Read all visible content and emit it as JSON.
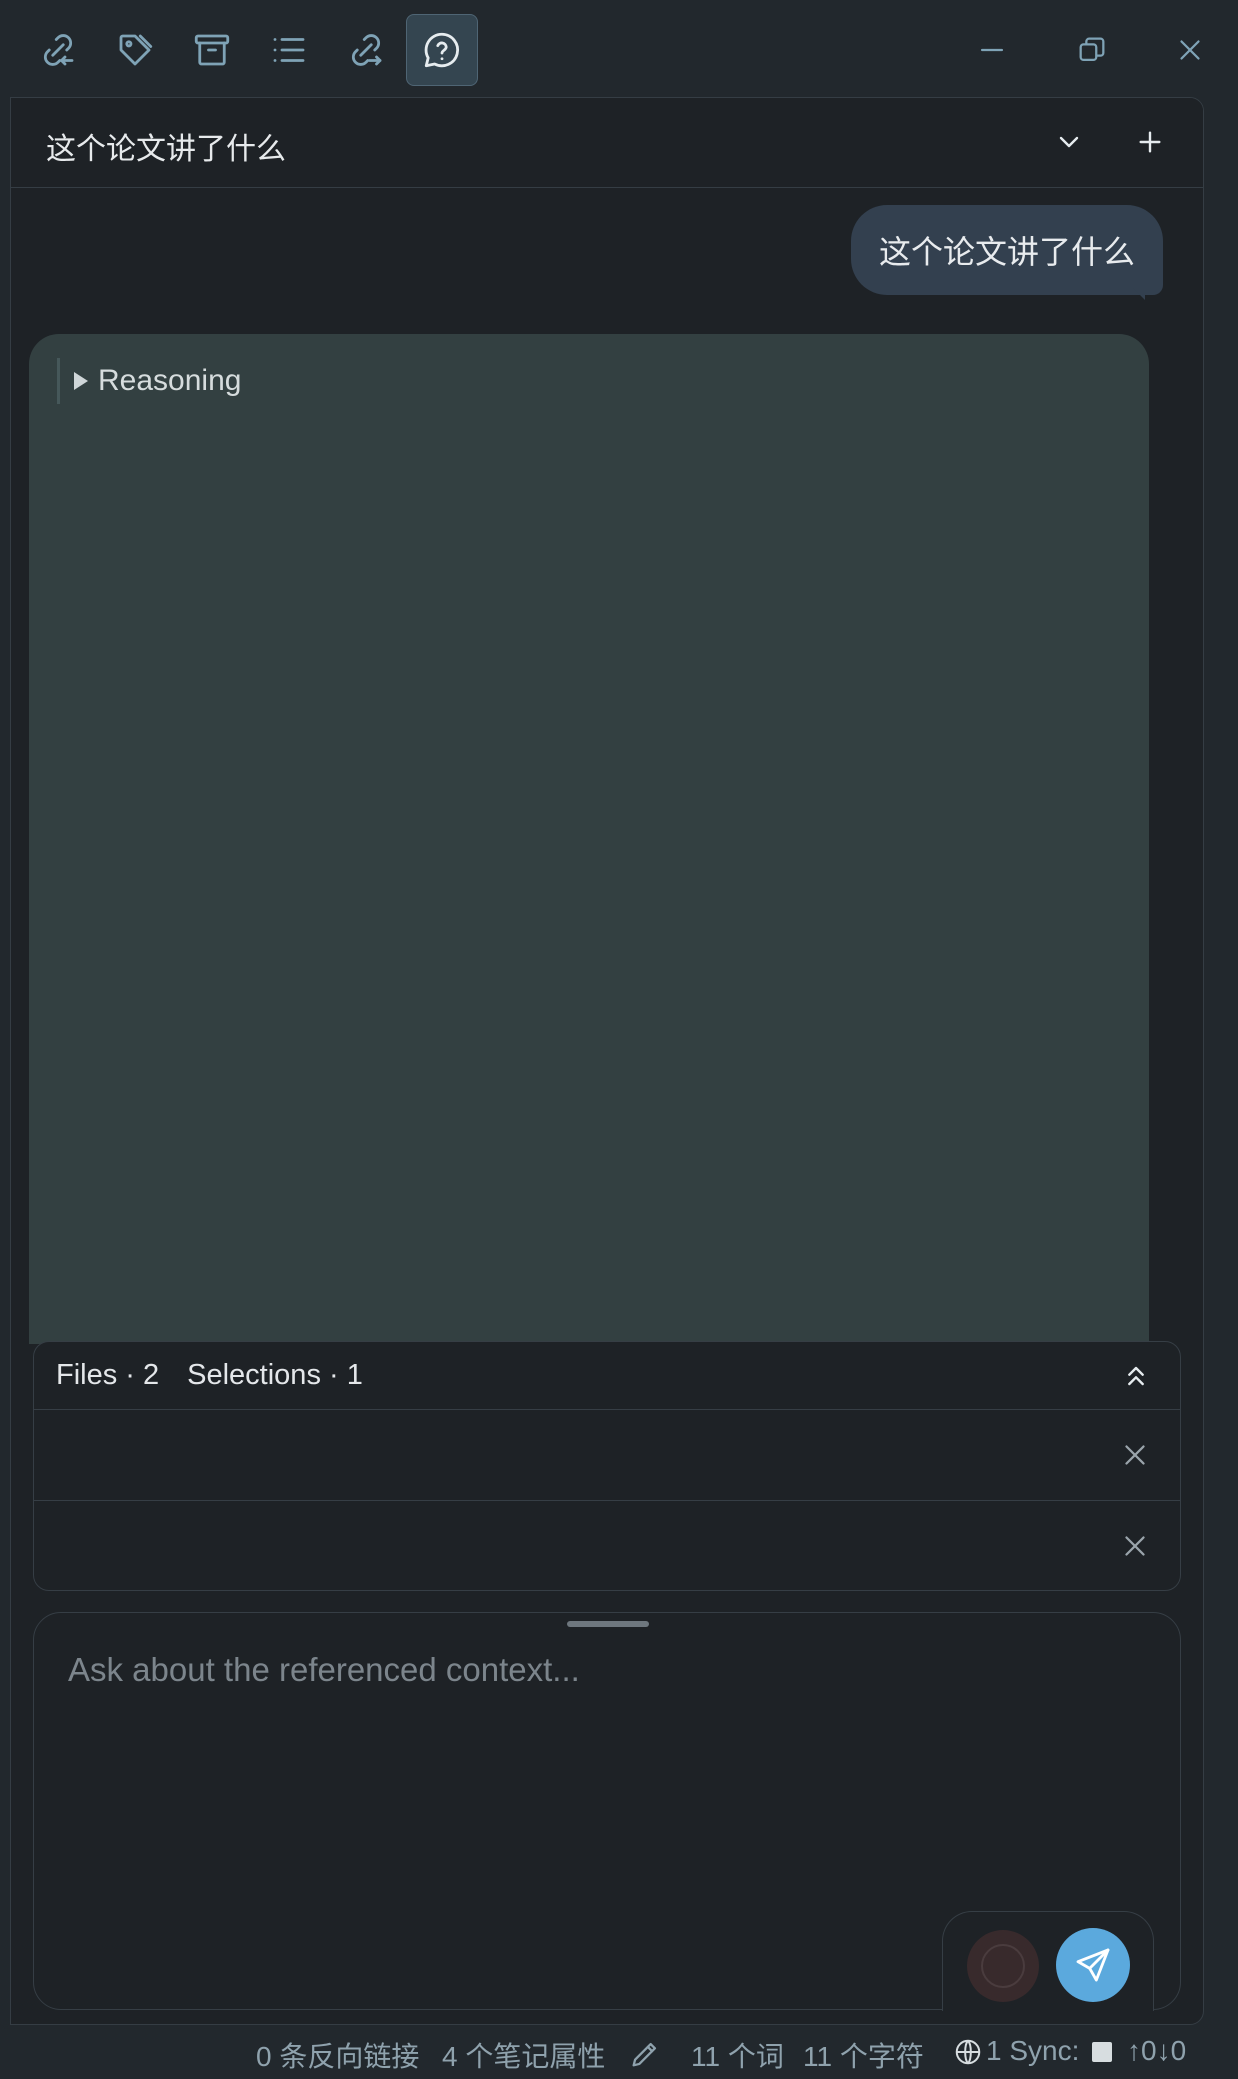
{
  "toolbar": {
    "icons": [
      "backlink-icon",
      "tag-icon",
      "archive-icon",
      "outline-list-icon",
      "outgoing-link-icon",
      "chat-help-icon"
    ],
    "active": "chat-help-icon"
  },
  "window_controls": [
    "minimize-icon",
    "restore-icon",
    "close-icon"
  ],
  "chat": {
    "title": "这个论文讲了什么",
    "user_message": "这个论文讲了什么",
    "reasoning_label": "Reasoning"
  },
  "context": {
    "files_label": "Files · 2",
    "selections_label": "Selections · 1"
  },
  "composer": {
    "placeholder": "Ask about the referenced context..."
  },
  "status": {
    "backlinks": "0 条反向链接",
    "properties": "4 个笔记属性",
    "words": "11 个词",
    "chars": "11 个字符",
    "sync_count": "1 Sync:",
    "sync_arrows": "↑0↓0"
  },
  "colors": {
    "background": "#22282d",
    "panel": "#1e2226",
    "ai_card": "#334041",
    "user_bubble": "#33404f",
    "accent": "#5ba9dd",
    "icon": "#7fa3b6"
  }
}
